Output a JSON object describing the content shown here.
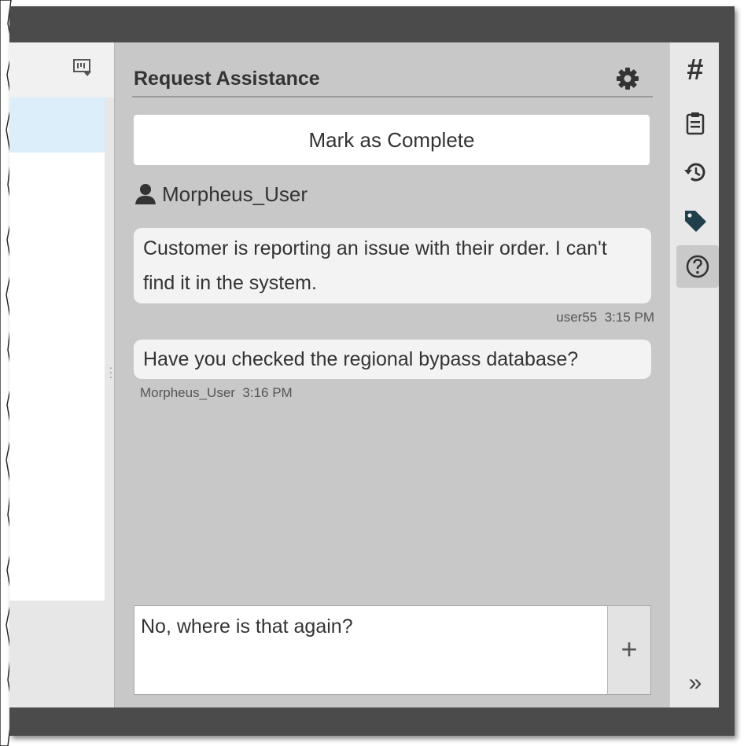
{
  "panel": {
    "title": "Request Assistance",
    "complete_button": "Mark as Complete",
    "assigned_user": "Morpheus_User"
  },
  "messages": [
    {
      "text": "Customer is reporting an issue with their order. I can't find it in the system.",
      "author": "user55",
      "time": "3:15 PM"
    },
    {
      "text": "Have you checked the regional bypass database?",
      "author": "Morpheus_User",
      "time": "3:16 PM"
    }
  ],
  "composer": {
    "value": "No, where is that again?",
    "add_label": "+"
  },
  "right_bar": {
    "hash_label": "#",
    "expand_label": "»",
    "icons": [
      "hash-icon",
      "clipboard-icon",
      "history-icon",
      "tag-icon",
      "help-icon",
      "expand-icon"
    ]
  },
  "colors": {
    "frame": "#4b4b4b",
    "chat_bg": "#c8c8c8",
    "bubble": "#f3f3f3",
    "selected_row": "#dbeefa"
  }
}
